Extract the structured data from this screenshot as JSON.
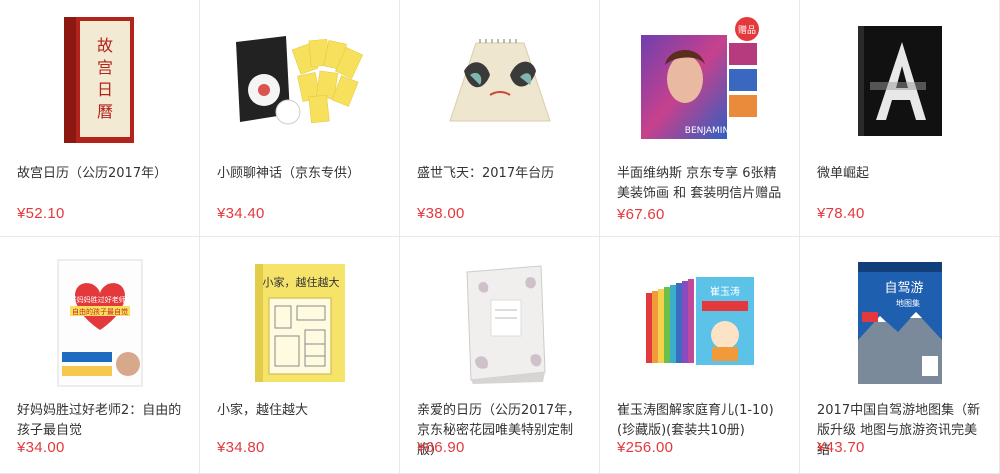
{
  "products": [
    {
      "title": "故宫日历（公历2017年）",
      "price": "¥52.10",
      "icon": "book-cover-palace-calendar"
    },
    {
      "title": "小顾聊神话（京东专供）",
      "price": "¥34.40",
      "icon": "book-cover-mythology"
    },
    {
      "title": "盛世飞天：2017年台历",
      "price": "¥38.00",
      "icon": "desk-calendar"
    },
    {
      "title": "半面维纳斯 京东专享 6张精美装饰画 和 套装明信片赠品",
      "price": "¥67.60",
      "icon": "book-cover-venus",
      "cover_text": "BENJAMIN",
      "badge": "赠品"
    },
    {
      "title": "微单崛起",
      "price": "¥78.40",
      "icon": "book-cover-black-a"
    },
    {
      "title": "好妈妈胜过好老师2：自由的孩子最自觉",
      "price": "¥34.00",
      "icon": "book-cover-good-mom",
      "cover_text": "好妈妈胜过好老师2",
      "cover_sub": "自由的孩子最自觉"
    },
    {
      "title": "小家，越住越大",
      "price": "¥34.80",
      "icon": "book-cover-small-home",
      "cover_text": "小家，越住越大"
    },
    {
      "title": "亲爱的日历（公历2017年，京东秘密花园唯美特别定制版）",
      "price": "¥66.90",
      "icon": "box-calendar"
    },
    {
      "title": "崔玉涛图解家庭育儿(1-10)(珍藏版)(套装共10册)",
      "price": "¥256.00",
      "icon": "book-set-parenting",
      "cover_text": "崔玉涛"
    },
    {
      "title": "2017中国自驾游地图集（新版升级 地图与旅游资讯完美结",
      "price": "¥43.70",
      "icon": "book-cover-road-atlas",
      "cover_text": "自驾游",
      "cover_sub": "地图集"
    }
  ]
}
